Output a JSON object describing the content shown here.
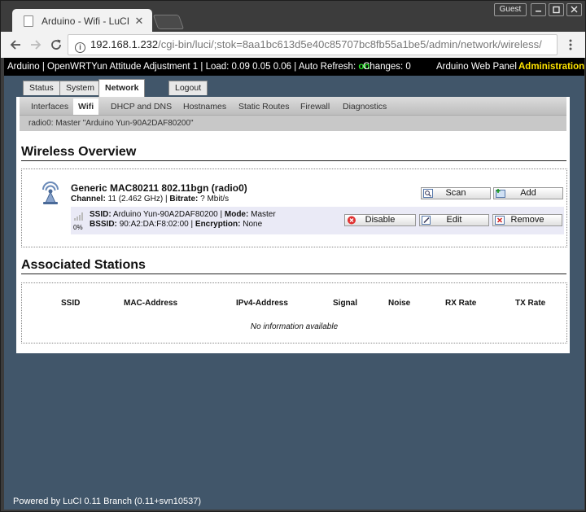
{
  "browser": {
    "tab_title": "Arduino - Wifi - LuCI",
    "tab_close": "✕",
    "guest_label": "Guest",
    "url_host": "192.168.1.232",
    "url_path": "/cgi-bin/luci/;stok=8aa1bc613d5e40c85707bc8fb55a1be5/admin/network/wireless/",
    "back_icon": "arrow-left-icon",
    "forward_icon": "arrow-right-icon",
    "reload_icon": "reload-icon"
  },
  "topbar": {
    "status_text": "Arduino | OpenWRTYun Attitude Adjustment 1 | Load: 0.09 0.05 0.06 | Auto Refresh: ",
    "auto_refresh_value": "on",
    "changes": "Changes: 0",
    "web_panel": "Arduino Web Panel",
    "administration": "Administration",
    "on_color": "#28e028",
    "admin_color": "#ffe400"
  },
  "main_nav": {
    "status": "Status",
    "system": "System",
    "network": "Network",
    "logout": "Logout"
  },
  "sub_nav": {
    "interfaces": "Interfaces",
    "wifi": "Wifi",
    "dhcp": "DHCP and DNS",
    "hostnames": "Hostnames",
    "static_routes": "Static Routes",
    "firewall": "Firewall",
    "diagnostics": "Diagnostics"
  },
  "breadcrumb": "radio0: Master \"Arduino Yun-90A2DAF80200\"",
  "wireless": {
    "heading": "Wireless Overview",
    "radio_name": "Generic MAC80211 802.11bgn (radio0)",
    "channel_label": "Channel:",
    "channel_value": "11 (2.462 GHz)",
    "bitrate_label": "Bitrate:",
    "bitrate_value": "? Mbit/s",
    "scan": "Scan",
    "add": "Add",
    "signal_pct": "0%",
    "ssid_label": "SSID:",
    "ssid_value": "Arduino Yun-90A2DAF80200",
    "mode_label": "Mode:",
    "mode_value": "Master",
    "bssid_label": "BSSID:",
    "bssid_value": "90:A2:DA:F8:02:00",
    "encryption_label": "Encryption:",
    "encryption_value": "None",
    "disable": "Disable",
    "edit": "Edit",
    "remove": "Remove"
  },
  "associated": {
    "heading": "Associated Stations",
    "columns": [
      "SSID",
      "MAC-Address",
      "IPv4-Address",
      "Signal",
      "Noise",
      "RX Rate",
      "TX Rate"
    ],
    "empty": "No information available"
  },
  "footer": "Powered by LuCI 0.11 Branch (0.11+svn10537)"
}
